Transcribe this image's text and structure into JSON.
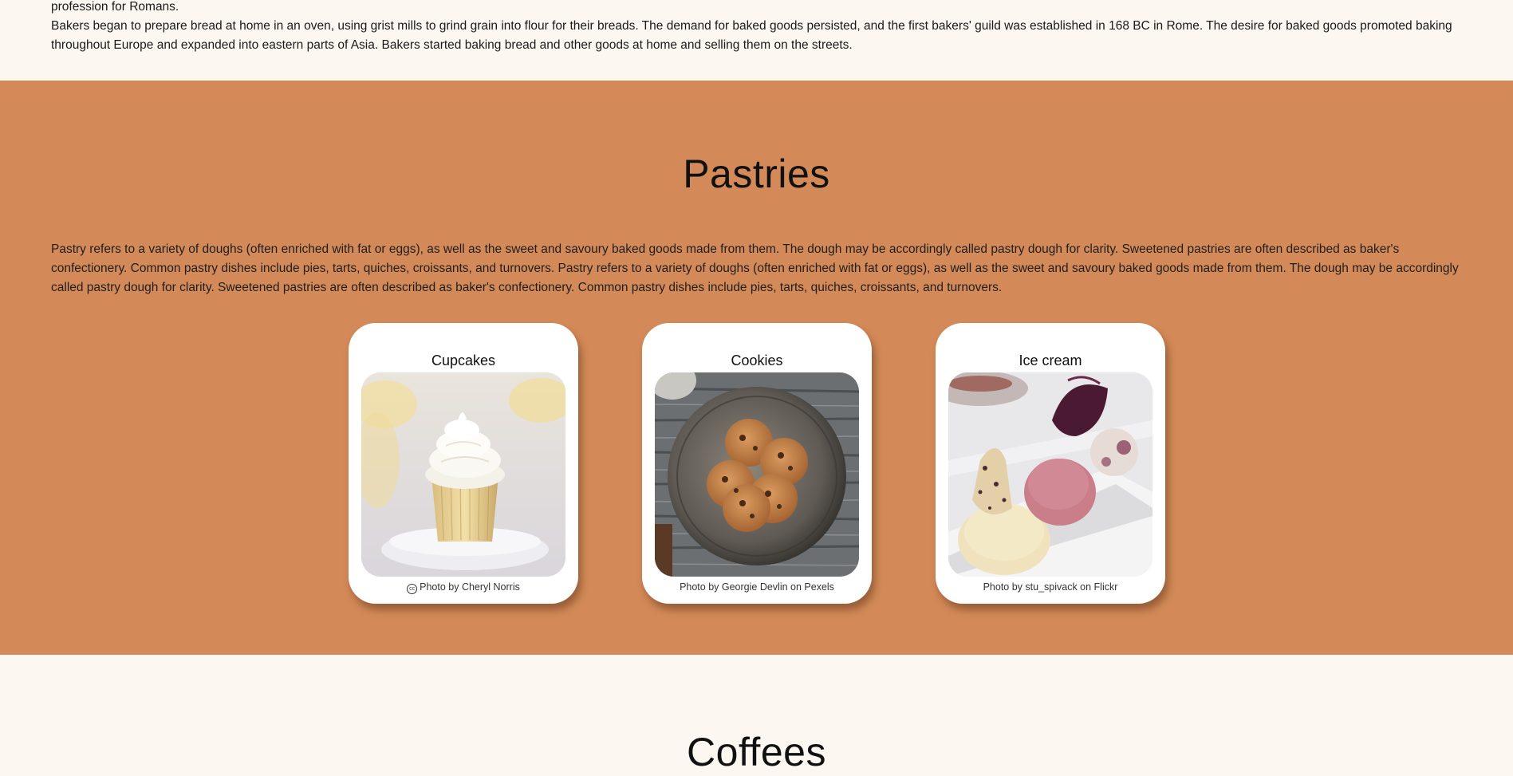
{
  "intro": {
    "line1": "profession for Romans.",
    "paragraph": "Bakers began to prepare bread at home in an oven, using grist mills to grind grain into flour for their breads. The demand for baked goods persisted, and the first bakers' guild was established in 168 BC in Rome. The desire for baked goods promoted baking throughout Europe and expanded into eastern parts of Asia. Bakers started baking bread and other goods at home and selling them on the streets."
  },
  "pastries": {
    "title": "Pastries",
    "paragraph": "Pastry refers to a variety of doughs (often enriched with fat or eggs), as well as the sweet and savoury baked goods made from them. The dough may be accordingly called pastry dough for clarity. Sweetened pastries are often described as baker's confectionery. Common pastry dishes include pies, tarts, quiches, croissants, and turnovers. Pastry refers to a variety of doughs (often enriched with fat or eggs), as well as the sweet and savoury baked goods made from them. The dough may be accordingly called pastry dough for clarity. Sweetened pastries are often described as baker's confectionery. Common pastry dishes include pies, tarts, quiches, croissants, and turnovers.",
    "background_color": "#d48a58",
    "cards": [
      {
        "title": "Cupcakes",
        "credit": "Photo by Cheryl Norris",
        "cc_icon": "creative-commons-icon"
      },
      {
        "title": "Cookies",
        "credit": "Photo by Georgie Devlin on Pexels"
      },
      {
        "title": "Ice cream",
        "credit": "Photo by stu_spivack on Flickr"
      }
    ]
  },
  "coffees": {
    "title": "Coffees"
  }
}
